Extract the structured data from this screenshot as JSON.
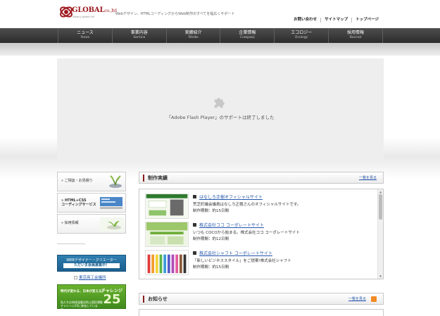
{
  "header": {
    "logo_text": "GLOBAL",
    "logo_suffix": "co.,ltd",
    "logo_sub": "www.is-global.net",
    "tagline": "Webデザイン、HTMLコーディングからWeb制作のすべてを幅広くサポート",
    "top_links": [
      "お問い合わせ",
      "サイトマップ",
      "トップページ"
    ]
  },
  "nav": [
    {
      "ja": "ニュース",
      "en": "News"
    },
    {
      "ja": "事業内容",
      "en": "Service"
    },
    {
      "ja": "実績紹介",
      "en": "Works"
    },
    {
      "ja": "企業情報",
      "en": "Company"
    },
    {
      "ja": "エコロジー",
      "en": "Ecology"
    },
    {
      "ja": "採用情報",
      "en": "Recruit"
    }
  ],
  "flash": {
    "message": "「Adobe Flash Player」のサポートは終了しました",
    "icon": "puzzle-piece-icon"
  },
  "sidebar": {
    "items": [
      {
        "label": "» ご相談・お見積り",
        "icon": "plant-icon"
      },
      {
        "label": "» HTML+CSS\nコーディングサービス",
        "icon": "code-icon"
      },
      {
        "label": "» 採用情報",
        "icon": "sprout-icon"
      }
    ],
    "banner_designer": {
      "line1": "WEBデザイナー・クリエーター",
      "line2": "ただいま会員募集中！"
    },
    "tokyo_link": "東京商工会議所",
    "challenge": {
      "line1": "時代が変わる、日本が変える。",
      "line2": "私たちは地球温暖化防止国民運動\nチャレンジ25に参加しています。",
      "label": "チャレンジ",
      "number": "25"
    }
  },
  "works": {
    "title": "制作実績",
    "more": "一覧を見る",
    "items": [
      {
        "title": "はなしろ正樹オフィシャルサイト",
        "desc": "荒芝町議会議員はなしろ正樹さんのオフィシャルサイトです。",
        "period": "制作期間：約15日間",
        "color": "#2e7a2e"
      },
      {
        "title": "株式会社ココ コーポレートサイト",
        "desc": "いつも COCOから始まる。株式会社ココ コーポレートサイト",
        "period": "制作期間：約12日間",
        "color": "#6fae3a"
      },
      {
        "title": "株式会社シャフト コーポレートサイト",
        "desc": "「新しいビジネススタイル」をご提案!株式会社シャフト",
        "period": "制作期間：約15日間",
        "color": "#d8a53a"
      }
    ]
  },
  "news": {
    "title": "お知らせ",
    "more": "一覧を見る"
  },
  "colors": {
    "brand": "#9d1a1f",
    "nav_bg": "#3a3a3a",
    "link": "#2255aa"
  }
}
